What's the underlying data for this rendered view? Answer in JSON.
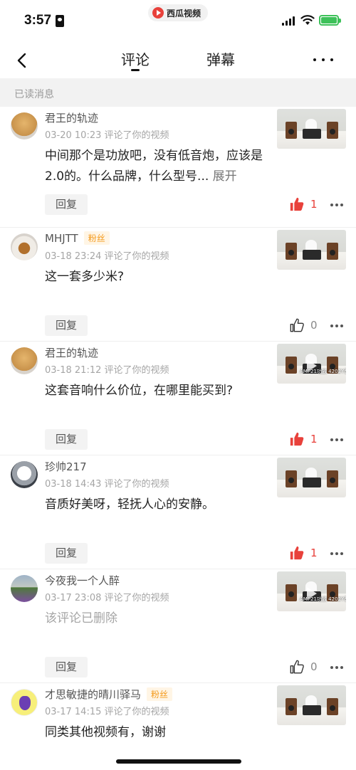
{
  "status_bar": {
    "time": "3:57",
    "app_name": "西瓜视频"
  },
  "nav": {
    "tabs": [
      "评论",
      "弹幕"
    ]
  },
  "section_header": "已读消息",
  "comments": [
    {
      "username": "君王的轨迹",
      "badge": "",
      "date": "03-20 10:23",
      "action": "评论了你的视频",
      "text": "中间那个是功放吧，没有低音炮，应该是2.0的。什么品牌，什么型号...",
      "expand": "展开",
      "reply": "回复",
      "likes": "1",
      "liked": true,
      "thumb_text": ""
    },
    {
      "username": "MHJTT",
      "badge": "粉丝",
      "date": "03-18 23:24",
      "action": "评论了你的视频",
      "text": "这一套多少米?",
      "expand": "",
      "reply": "回复",
      "likes": "0",
      "liked": false,
      "thumb_text": ""
    },
    {
      "username": "君王的轨迹",
      "badge": "",
      "date": "03-18 21:12",
      "action": "评论了你的视频",
      "text": "这套音响什么价位，在哪里能买到?",
      "expand": "",
      "reply": "回复",
      "likes": "1",
      "liked": true,
      "thumb_text": "AMP21功放 4202Y音箱"
    },
    {
      "username": "珍帅217",
      "badge": "",
      "date": "03-18 14:43",
      "action": "评论了你的视频",
      "text": "音质好美呀，轻抚人心的安静。",
      "expand": "",
      "reply": "回复",
      "likes": "1",
      "liked": true,
      "thumb_text": ""
    },
    {
      "username": "今夜我一个人醉",
      "badge": "",
      "date": "03-17 23:08",
      "action": "评论了你的视频",
      "text": "该评论已删除",
      "expand": "",
      "reply": "回复",
      "likes": "0",
      "liked": false,
      "deleted": true,
      "thumb_text": "AMP21功放 4202Y音箱"
    },
    {
      "username": "才思敏捷的晴川驿马",
      "badge": "粉丝",
      "date": "03-17 14:15",
      "action": "评论了你的视频",
      "text": "同类其他视频有，谢谢",
      "expand": "",
      "reply": "回复",
      "likes": "0",
      "liked": false,
      "thumb_text": ""
    }
  ]
}
